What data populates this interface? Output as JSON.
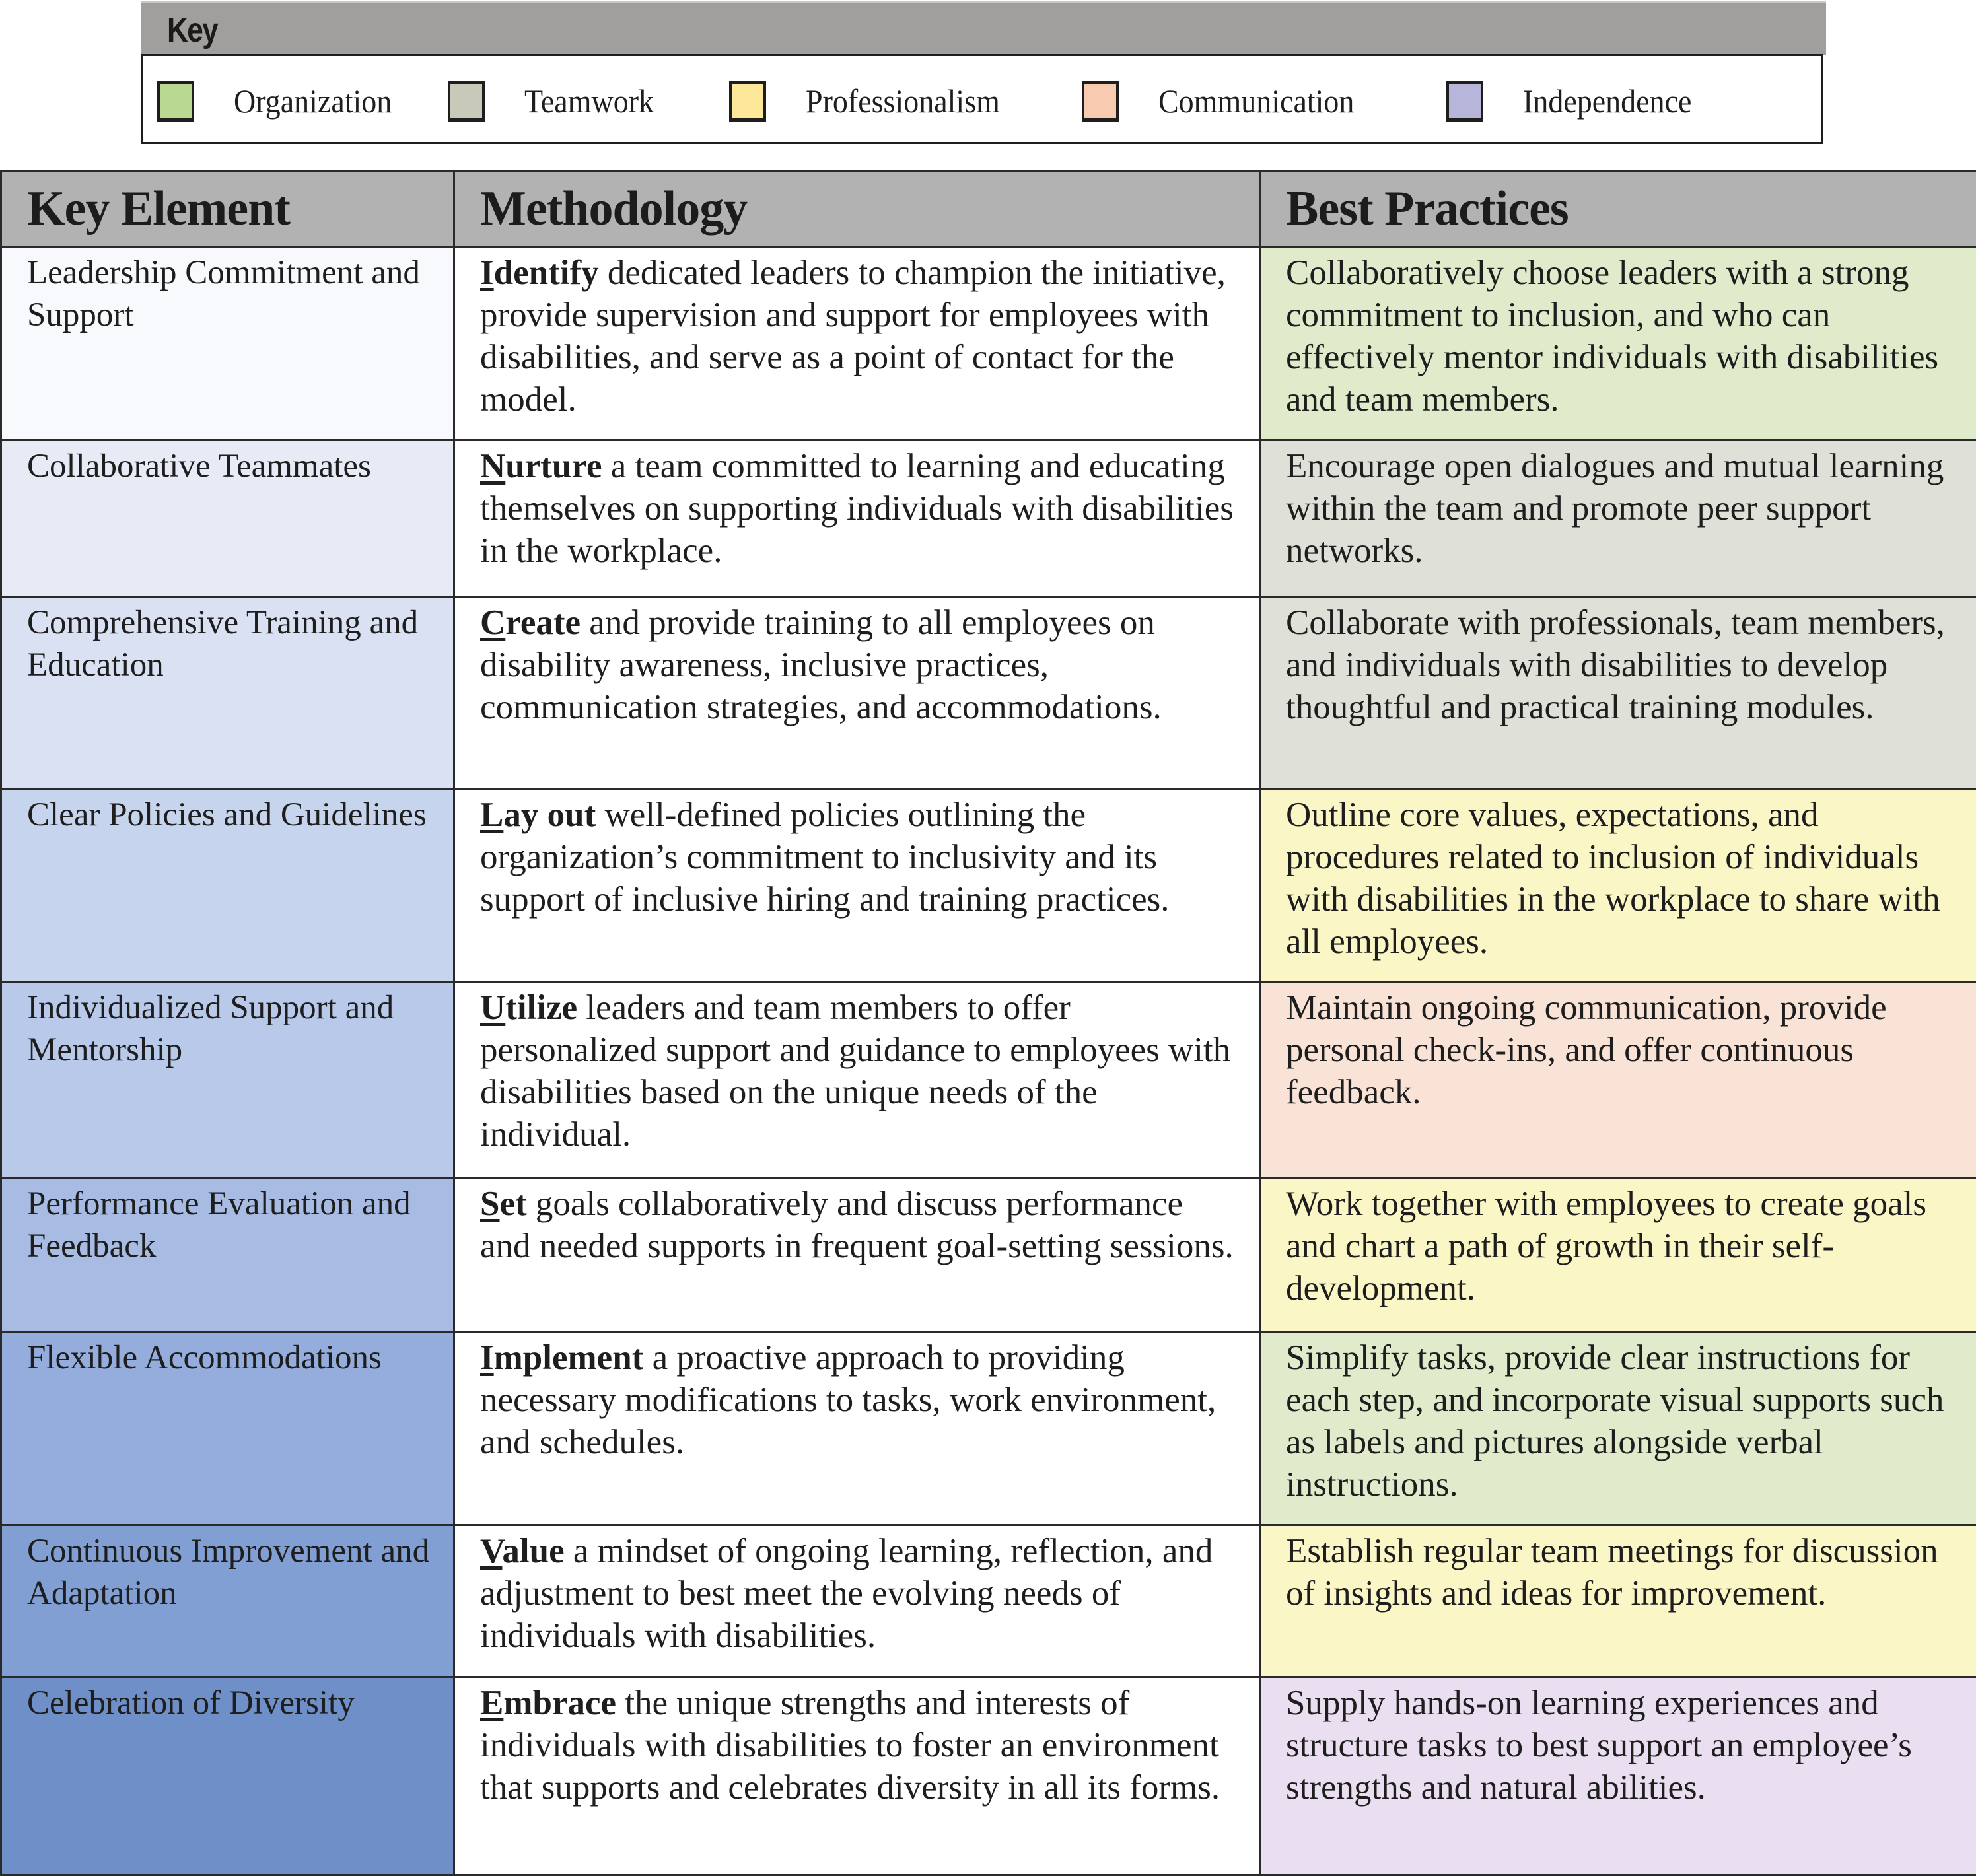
{
  "key": {
    "title": "Key",
    "items": [
      {
        "label": "Organization",
        "color": "#b9d993"
      },
      {
        "label": "Teamwork",
        "color": "#c8c9b9"
      },
      {
        "label": "Professionalism",
        "color": "#fde899"
      },
      {
        "label": "Communication",
        "color": "#f8cbb0"
      },
      {
        "label": "Independence",
        "color": "#b7b5da"
      }
    ]
  },
  "table": {
    "headers": [
      "Key Element",
      "Methodology",
      "Best Practices"
    ],
    "rows": [
      {
        "element": "Leadership Commitment and Support",
        "element_bg": "#f7f9fd",
        "method_lead_first": "I",
        "method_lead_rest": "dentify",
        "method_text": " dedicated leaders to champion the initiative, provide supervision and support for employees with disabilities, and serve as a point of contact for the model.",
        "practice": "Collaboratively choose leaders with a strong commitment to inclusion, and who can effectively mentor individuals with disabilities and team members.",
        "category": "Organization",
        "practice_bg": "#dfebcb"
      },
      {
        "element": "Collaborative  Teammates",
        "element_bg": "#e6ebf6",
        "method_lead_first": "N",
        "method_lead_rest": "urture",
        "method_text": " a team committed to learning and educating themselves on supporting individuals with disabilities in the workplace.",
        "practice": "Encourage open dialogues and mutual learning within the team and promote peer support networks.",
        "category": "Teamwork",
        "practice_bg": "#dfe0d8"
      },
      {
        "element": "Comprehensive Training and Education",
        "element_bg": "#d9e1f2",
        "method_lead_first": "C",
        "method_lead_rest": "reate",
        "method_text": " and provide training to all employees on disability awareness, inclusive practices, communication strategies, and accommodations.",
        "practice": "Collaborate with professionals, team members, and individuals with disabilities to develop thoughtful and practical training modules.",
        "category": "Teamwork",
        "practice_bg": "#dfe0d8"
      },
      {
        "element": "Clear Policies and Guidelines",
        "element_bg": "#c7d4ed",
        "method_lead_first": "L",
        "method_lead_rest": "ay out",
        "method_text": " well-defined policies outlining the organization’s commitment to inclusivity and its support of inclusive hiring and training practices.",
        "practice": "Outline core values, expectations, and procedures related to inclusion of individuals with disabilities in the workplace to share with all employees.",
        "category": "Professionalism",
        "practice_bg": "#faf6c6"
      },
      {
        "element": "Individualized Support and Mentorship",
        "element_bg": "#b9c9ea",
        "method_lead_first": "U",
        "method_lead_rest": "tilize",
        "method_text": " leaders and team members to offer personalized support and guidance to employees with disabilities based on the unique needs of the individual.",
        "practice": "Maintain ongoing communication, provide personal check-ins, and offer continuous feedback.",
        "category": "Communication",
        "practice_bg": "#f9e2d6"
      },
      {
        "element": "Performance Evaluation and Feedback",
        "element_bg": "#a8bbe3",
        "method_lead_first": "S",
        "method_lead_rest": "et",
        "method_text": " goals collaboratively and discuss performance and needed supports in frequent goal-setting sessions.",
        "practice": "Work together with employees to create goals and chart a path of growth in their self-development.",
        "category": "Professionalism",
        "practice_bg": "#faf6c6"
      },
      {
        "element": "Flexible Accommodations",
        "element_bg": "#95addc",
        "method_lead_first": "I",
        "method_lead_rest": "mplement",
        "method_text": " a proactive approach to providing necessary modifications to tasks, work environment, and schedules.",
        "practice": "Simplify tasks, provide clear instructions for each step, and incorporate visual supports such as labels and pictures alongside verbal instructions.",
        "category": "Organization",
        "practice_bg": "#dfebcb"
      },
      {
        "element": "Continuous Improvement and Adaptation",
        "element_bg": "#819fd3",
        "method_lead_first": "V",
        "method_lead_rest": "alue",
        "method_text": " a mindset of ongoing learning, reflection, and adjustment to best meet the evolving needs of individuals with disabilities.",
        "practice": "Establish regular team meetings for discussion of insights and ideas for improvement.",
        "category": "Professionalism",
        "practice_bg": "#faf6c6"
      },
      {
        "element": "Celebration of Diversity",
        "element_bg": "#6f8fc9",
        "method_lead_first": "E",
        "method_lead_rest": "mbrace",
        "method_text": " the unique strengths and interests of individuals with disabilities to foster an environment that supports and celebrates diversity in all its forms.",
        "practice": "Supply hands-on learning experiences and structure tasks to best support an employee’s strengths and natural abilities.",
        "category": "Independence",
        "practice_bg": "#e9dff0"
      }
    ]
  }
}
